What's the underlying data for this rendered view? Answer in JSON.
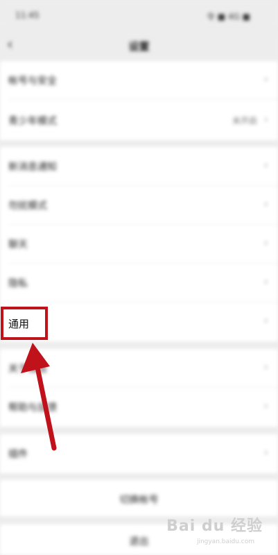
{
  "status_bar": {
    "time": "11:45",
    "right_info": "令 ■ 4G ■"
  },
  "header": {
    "back_icon": "chevron-left-icon",
    "title": "设置"
  },
  "settings": {
    "group1": [
      {
        "label": "帐号与安全",
        "value": ""
      },
      {
        "label": "青少年模式",
        "value": "未开启"
      }
    ],
    "group2": [
      {
        "label": "新消息通知",
        "value": ""
      },
      {
        "label": "勿扰模式",
        "value": ""
      },
      {
        "label": "聊天",
        "value": ""
      },
      {
        "label": "隐私",
        "value": ""
      },
      {
        "label": "通用",
        "value": ""
      }
    ],
    "group3": [
      {
        "label": "关于微信",
        "value": ""
      },
      {
        "label": "帮助与反馈",
        "value": ""
      }
    ],
    "group4": [
      {
        "label": "插件",
        "value": ""
      }
    ],
    "actions": {
      "switch_account": "切换帐号",
      "logout": "退出"
    }
  },
  "annotation": {
    "highlight_label": "通用",
    "color": "#c0121a"
  },
  "watermark": {
    "brand": "Bai du 经验",
    "url": "jingyan.baidu.com"
  }
}
